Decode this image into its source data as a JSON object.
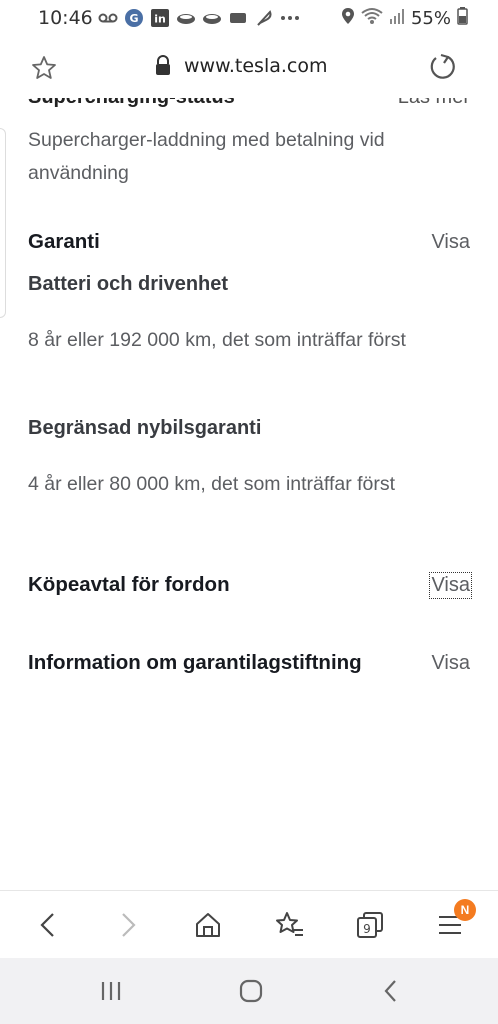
{
  "status_bar": {
    "time": "10:46",
    "battery": "55%",
    "icons_left": [
      "voicemail-icon",
      "g-app-icon",
      "linkedin-icon",
      "cloud-icon",
      "cloud-icon",
      "video-icon",
      "feather-icon",
      "more-dots-icon"
    ],
    "icons_right": [
      "location-icon",
      "wifi-icon",
      "signal-icon",
      "battery-icon"
    ]
  },
  "browser": {
    "url": "www.tesla.com",
    "tab_count": "9",
    "menu_badge": "N"
  },
  "content": {
    "clipped_section": {
      "title": "Supercharging-status",
      "link": "Läs mer"
    },
    "supercharging_text": "Supercharger-laddning med betalning vid användning",
    "garanti": {
      "title": "Garanti",
      "link": "Visa",
      "items": [
        {
          "heading": "Batteri och drivenhet",
          "text": "8 år eller 192 000 km, det som inträffar först"
        },
        {
          "heading": "Begränsad nybilsgaranti",
          "text": "4 år eller 80 000 km, det som inträffar först"
        }
      ]
    },
    "kopeavtal": {
      "title": "Köpeavtal för fordon",
      "link": "Visa"
    },
    "information": {
      "title": "Information om garantilagstiftning",
      "link": "Visa"
    }
  },
  "colors": {
    "accent_badge": "#f47b20",
    "body_text": "#5c5e62",
    "heading_text": "#171a20"
  }
}
